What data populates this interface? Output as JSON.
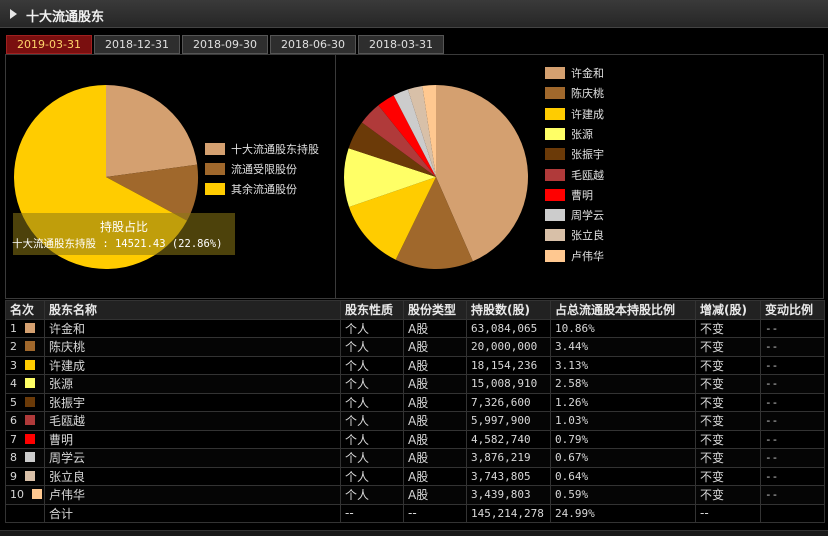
{
  "header": {
    "title": "十大流通股东"
  },
  "tabs": [
    {
      "label": "2019-03-31",
      "active": true
    },
    {
      "label": "2018-12-31",
      "active": false
    },
    {
      "label": "2018-09-30",
      "active": false
    },
    {
      "label": "2018-06-30",
      "active": false
    },
    {
      "label": "2018-03-31",
      "active": false
    }
  ],
  "pie1": {
    "legend": [
      {
        "label": "十大流通股东持股",
        "color": "#d4a070",
        "pct": 22.86
      },
      {
        "label": "流通受限股份",
        "color": "#a0682c",
        "pct": 10.0
      },
      {
        "label": "其余流通股份",
        "color": "#ffcc00",
        "pct": 67.14
      }
    ],
    "overlay_title": "持股占比",
    "overlay_text": "十大流通股东持股 : 14521.43 (22.86%)"
  },
  "pie2": {
    "legend": [
      {
        "label": "许金和",
        "color": "#d4a070"
      },
      {
        "label": "陈庆桃",
        "color": "#a0682c"
      },
      {
        "label": "许建成",
        "color": "#ffcc00"
      },
      {
        "label": "张源",
        "color": "#ffff66"
      },
      {
        "label": "张振宇",
        "color": "#6b3a08"
      },
      {
        "label": "毛瓯越",
        "color": "#b03a3a"
      },
      {
        "label": "曹明",
        "color": "#ff0000"
      },
      {
        "label": "周学云",
        "color": "#cccccc"
      },
      {
        "label": "张立良",
        "color": "#d8c0a8"
      },
      {
        "label": "卢伟华",
        "color": "#ffc890"
      }
    ]
  },
  "table": {
    "headers": [
      "名次",
      "股东名称",
      "股东性质",
      "股份类型",
      "持股数(股)",
      "占总流通股本持股比例",
      "增减(股)",
      "变动比例"
    ],
    "rows": [
      {
        "rank": "1",
        "name": "许金和",
        "nature": "个人",
        "type": "A股",
        "shares": "63,084,065",
        "ratio": "10.86%",
        "change": "不变",
        "chg_ratio": "--",
        "color": "#d4a070"
      },
      {
        "rank": "2",
        "name": "陈庆桃",
        "nature": "个人",
        "type": "A股",
        "shares": "20,000,000",
        "ratio": "3.44%",
        "change": "不变",
        "chg_ratio": "--",
        "color": "#a0682c"
      },
      {
        "rank": "3",
        "name": "许建成",
        "nature": "个人",
        "type": "A股",
        "shares": "18,154,236",
        "ratio": "3.13%",
        "change": "不变",
        "chg_ratio": "--",
        "color": "#ffcc00"
      },
      {
        "rank": "4",
        "name": "张源",
        "nature": "个人",
        "type": "A股",
        "shares": "15,008,910",
        "ratio": "2.58%",
        "change": "不变",
        "chg_ratio": "--",
        "color": "#ffff66"
      },
      {
        "rank": "5",
        "name": "张振宇",
        "nature": "个人",
        "type": "A股",
        "shares": "7,326,600",
        "ratio": "1.26%",
        "change": "不变",
        "chg_ratio": "--",
        "color": "#6b3a08"
      },
      {
        "rank": "6",
        "name": "毛瓯越",
        "nature": "个人",
        "type": "A股",
        "shares": "5,997,900",
        "ratio": "1.03%",
        "change": "不变",
        "chg_ratio": "--",
        "color": "#b03a3a"
      },
      {
        "rank": "7",
        "name": "曹明",
        "nature": "个人",
        "type": "A股",
        "shares": "4,582,740",
        "ratio": "0.79%",
        "change": "不变",
        "chg_ratio": "--",
        "color": "#ff0000"
      },
      {
        "rank": "8",
        "name": "周学云",
        "nature": "个人",
        "type": "A股",
        "shares": "3,876,219",
        "ratio": "0.67%",
        "change": "不变",
        "chg_ratio": "--",
        "color": "#cccccc"
      },
      {
        "rank": "9",
        "name": "张立良",
        "nature": "个人",
        "type": "A股",
        "shares": "3,743,805",
        "ratio": "0.64%",
        "change": "不变",
        "chg_ratio": "--",
        "color": "#d8c0a8"
      },
      {
        "rank": "10",
        "name": "卢伟华",
        "nature": "个人",
        "type": "A股",
        "shares": "3,439,803",
        "ratio": "0.59%",
        "change": "不变",
        "chg_ratio": "--",
        "color": "#ffc890"
      }
    ],
    "total": {
      "label": "合计",
      "nature": "--",
      "type": "--",
      "shares": "145,214,278",
      "ratio": "24.99%",
      "change": "--",
      "chg_ratio": ""
    }
  },
  "chart_data": [
    {
      "type": "pie",
      "categories": [
        "十大流通股东持股",
        "流通受限股份",
        "其余流通股份"
      ],
      "values": [
        22.86,
        10.0,
        67.14
      ]
    },
    {
      "type": "pie",
      "categories": [
        "许金和",
        "陈庆桃",
        "许建成",
        "张源",
        "张振宇",
        "毛瓯越",
        "曹明",
        "周学云",
        "张立良",
        "卢伟华"
      ],
      "values": [
        63084065,
        20000000,
        18154236,
        15008910,
        7326600,
        5997900,
        4582740,
        3876219,
        3743805,
        3439803
      ]
    }
  ]
}
